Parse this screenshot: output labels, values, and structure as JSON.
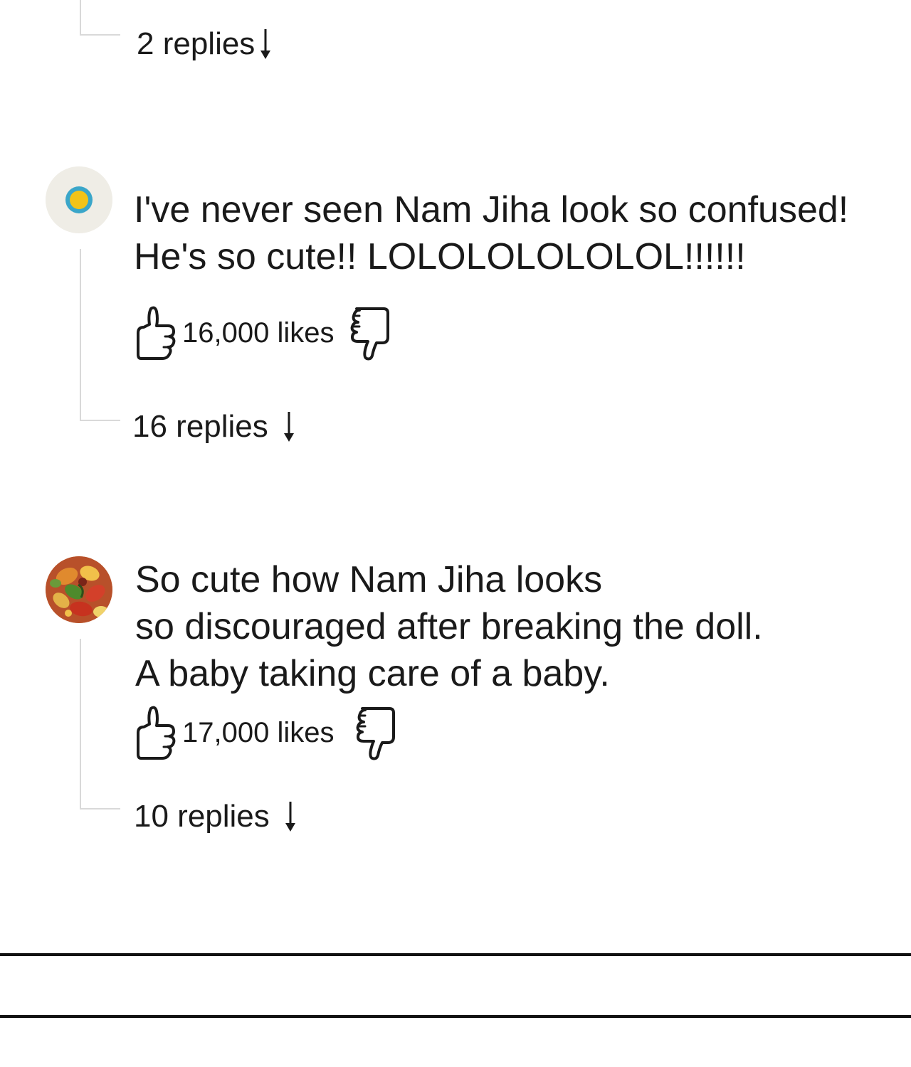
{
  "comments": [
    {
      "replies_label": "2 replies"
    },
    {
      "text_lines": [
        "I've never seen Nam Jiha look so confused!",
        "He's so cute!! LOLOLOLOLOLOL!!!!!!"
      ],
      "likes_label": "16,000 likes",
      "replies_label": "16 replies",
      "avatar_icon": "target-dot-avatar"
    },
    {
      "text_lines": [
        "So cute how Nam Jiha looks",
        "so discouraged after breaking the doll.",
        "A baby taking care of a baby."
      ],
      "likes_label": "17,000 likes",
      "replies_label": "10 replies",
      "avatar_icon": "floral-pattern-avatar"
    }
  ],
  "icons": {
    "like": "thumbs-up-icon",
    "dislike": "thumbs-down-icon",
    "expand": "arrow-down-icon"
  },
  "colors": {
    "text": "#1a1a1a",
    "thread_line": "#d9d9d9",
    "divider": "#111111",
    "avatar1_bg": "#efede6",
    "avatar1_ring": "#3aa6c9",
    "avatar1_center": "#f2c318"
  }
}
